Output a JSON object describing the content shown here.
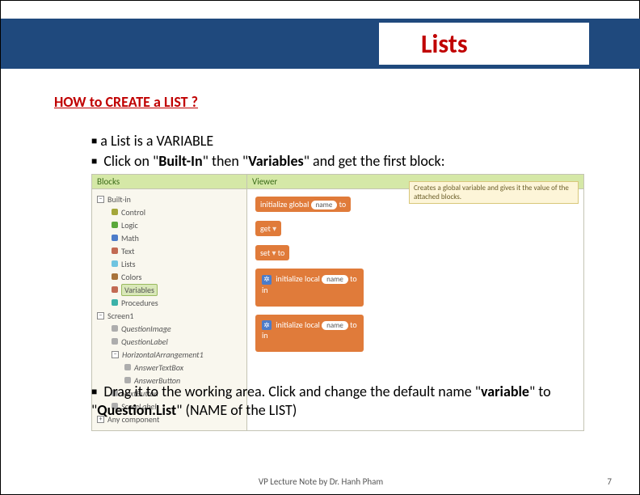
{
  "title": "Lists",
  "heading": "HOW to CREATE a LIST ?",
  "bullets_top": {
    "b1": "a List is a VARIABLE",
    "b2_pre": " Click on \"",
    "b2_bold1": "Built-In",
    "b2_mid": "\" then \"",
    "b2_bold2": "Variables",
    "b2_post": "\" and get the first block:"
  },
  "bullets_bottom": {
    "pre": " Drag it to the working area. Click and change the default name \"",
    "bold1": "variable",
    "mid": "\" to \"",
    "bold2": "Question.List",
    "post": "\" (NAME of the LIST)"
  },
  "panes": {
    "blocks_label": "Blocks",
    "viewer_label": "Viewer"
  },
  "tree": {
    "builtin": "Built-in",
    "control": "Control",
    "logic": "Logic",
    "math": "Math",
    "text": "Text",
    "lists": "Lists",
    "colors": "Colors",
    "variables": "Variables",
    "procedures": "Procedures",
    "screen1": "Screen1",
    "qimage": "QuestionImage",
    "qlabel": "QuestionLabel",
    "harr": "HorizontalArrangement1",
    "ans": "AnswerTextBox",
    "abtn": "AnswerButton",
    "nbtn": "NextButton",
    "slabel": "ScoreLabel",
    "anyc": "Any component"
  },
  "blocks": {
    "init_global": "initialize global",
    "name": "name",
    "to": "to",
    "get": "get",
    "set": "set",
    "init_local": "initialize local",
    "in": "in"
  },
  "tooltip": "Creates a global variable and gives it the value of the attached blocks.",
  "footer": {
    "center": "VP Lecture Note by Dr. Hanh Pham",
    "page": "7"
  }
}
